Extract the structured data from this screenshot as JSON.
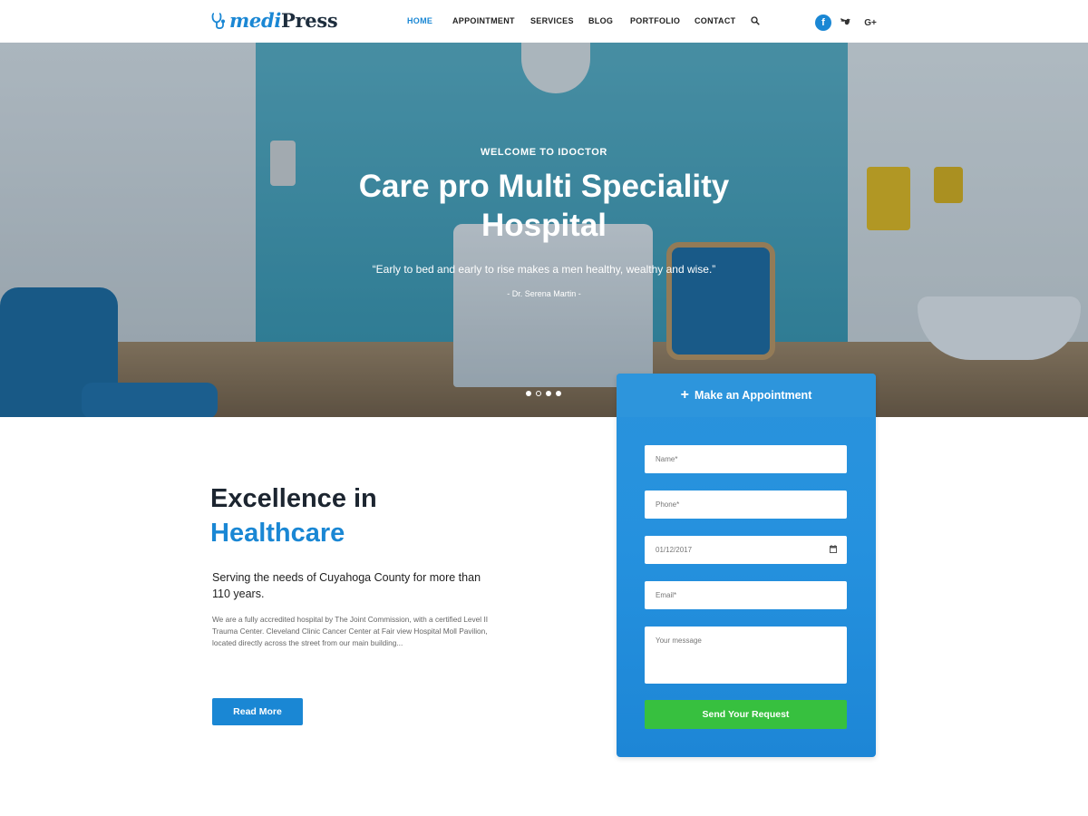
{
  "brand": {
    "logo_prefix": "medi",
    "logo_suffix": "Press"
  },
  "nav": {
    "items": [
      {
        "label": "HOME",
        "active": true
      },
      {
        "label": "APPOINTMENT",
        "active": false
      },
      {
        "label": "SERVICES",
        "active": false
      },
      {
        "label": "BLOG",
        "active": false
      },
      {
        "label": "PORTFOLIO",
        "active": false
      },
      {
        "label": "CONTACT",
        "active": false
      }
    ],
    "social": [
      "facebook-icon",
      "twitter-icon",
      "google-plus-icon"
    ],
    "social_fb": "f",
    "social_gp": "G+"
  },
  "hero": {
    "kicker": "WELCOME TO IDOCTOR",
    "title": "Care pro Multi Speciality Hospital",
    "quote": "“Early to bed and early to rise makes a men healthy, wealthy and wise.”",
    "author": "- Dr. Serena Martin -",
    "slides": 4,
    "active_slide": 2
  },
  "intro": {
    "title_line1": "Excellence in",
    "title_line2": "Healthcare",
    "subtitle": "Serving the needs of Cuyahoga County for more than 110 years.",
    "body": "We are a fully accredited hospital by The Joint Commission, with a certified Level II Trauma Center. Cleveland Clinic Cancer Center at Fair view Hospital Moll Pavilion, located directly across the street from our main building...",
    "read_more": "Read More"
  },
  "appointment": {
    "heading": "Make an Appointment",
    "name_placeholder": "Name*",
    "phone_placeholder": "Phone*",
    "date_value": "01/12/2017",
    "email_placeholder": "Email*",
    "message_placeholder": "Your message",
    "submit": "Send Your Request"
  },
  "colors": {
    "brand_blue": "#1a87d4",
    "success_green": "#37c03f"
  }
}
